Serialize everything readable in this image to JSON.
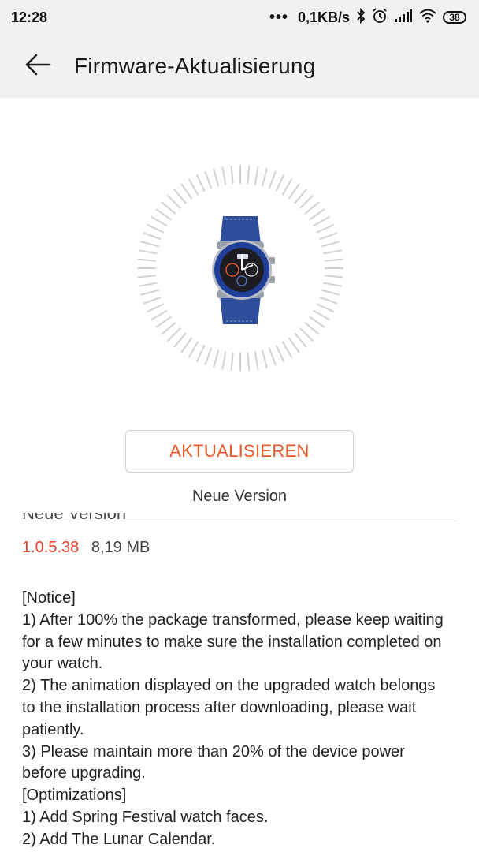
{
  "status_bar": {
    "time": "12:28",
    "dots": "•••",
    "network_speed": "0,1KB/s",
    "battery": "38"
  },
  "header": {
    "title": "Firmware-Aktualisierung"
  },
  "update": {
    "button_label": "AKTUALISIEREN",
    "caption": "Neue Version"
  },
  "details": {
    "heading": "Neue Version",
    "version": "1.0.5.38",
    "size": "8,19 MB",
    "notes": [
      "[Notice]",
      "1) After 100% the package transformed, please keep waiting for a few minutes to make sure the installation completed on your watch.",
      "2) The animation displayed on the upgraded watch belongs to the installation process after downloading, please wait patiently.",
      "3) Please maintain more than 20% of the device power before upgrading.",
      "[Optimizations]",
      "1) Add Spring Festival watch faces.",
      "2) Add The Lunar Calendar."
    ]
  },
  "colors": {
    "accent": "#e8582a",
    "version": "#e8402a",
    "bar_background": "#f1f1f1"
  }
}
